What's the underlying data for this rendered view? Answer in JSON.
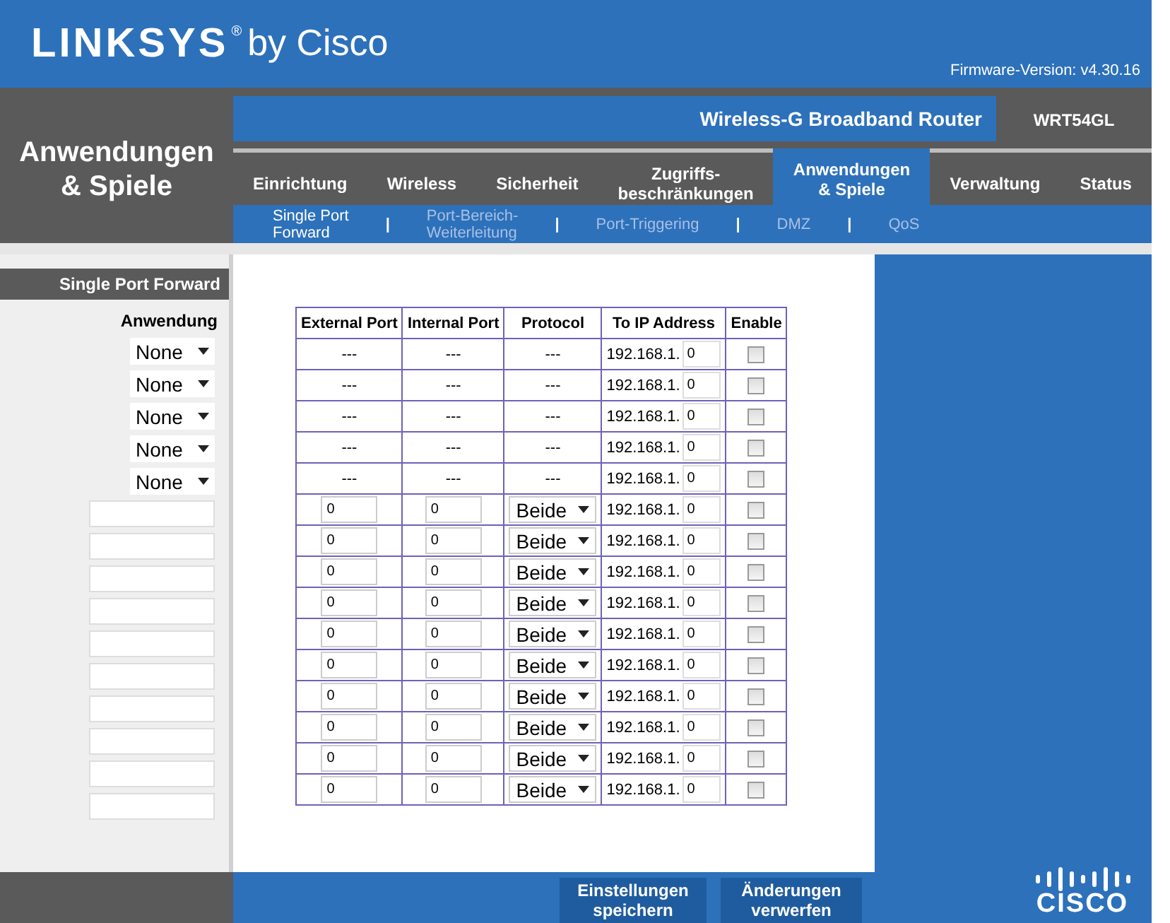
{
  "header": {
    "brand": "LINKSYS",
    "registered": "®",
    "by": "by Cisco",
    "firmware": "Firmware-Version: v4.30.16"
  },
  "section_title": "Anwendungen\n& Spiele",
  "product": {
    "name": "Wireless-G Broadband Router",
    "model": "WRT54GL"
  },
  "tabs": [
    {
      "label": "Einrichtung",
      "selected": false
    },
    {
      "label": "Wireless",
      "selected": false
    },
    {
      "label": "Sicherheit",
      "selected": false
    },
    {
      "label": "Zugriffs-\nbeschränkungen",
      "selected": false
    },
    {
      "label": "Anwendungen\n& Spiele",
      "selected": true
    },
    {
      "label": "Verwaltung",
      "selected": false
    },
    {
      "label": "Status",
      "selected": false
    }
  ],
  "subtabs": [
    {
      "label": "Single Port\nForward",
      "selected": true
    },
    {
      "label": "Port-Bereich-\nWeiterleitung",
      "selected": false
    },
    {
      "label": "Port-Triggering",
      "selected": false
    },
    {
      "label": "DMZ",
      "selected": false
    },
    {
      "label": "QoS",
      "selected": false
    }
  ],
  "subtab_separator": "|",
  "sidebar": {
    "title": "Single Port Forward",
    "column_label": "Anwendung"
  },
  "table": {
    "columns": [
      "External Port",
      "Internal Port",
      "Protocol",
      "To IP Address",
      "Enable"
    ],
    "rows": [
      {
        "kind": "fixed",
        "application": "None",
        "external_port": "---",
        "internal_port": "---",
        "protocol": "---",
        "ip_prefix": "192.168.1.",
        "ip_last": "0",
        "enabled": false
      },
      {
        "kind": "fixed",
        "application": "None",
        "external_port": "---",
        "internal_port": "---",
        "protocol": "---",
        "ip_prefix": "192.168.1.",
        "ip_last": "0",
        "enabled": false
      },
      {
        "kind": "fixed",
        "application": "None",
        "external_port": "---",
        "internal_port": "---",
        "protocol": "---",
        "ip_prefix": "192.168.1.",
        "ip_last": "0",
        "enabled": false
      },
      {
        "kind": "fixed",
        "application": "None",
        "external_port": "---",
        "internal_port": "---",
        "protocol": "---",
        "ip_prefix": "192.168.1.",
        "ip_last": "0",
        "enabled": false
      },
      {
        "kind": "fixed",
        "application": "None",
        "external_port": "---",
        "internal_port": "---",
        "protocol": "---",
        "ip_prefix": "192.168.1.",
        "ip_last": "0",
        "enabled": false
      },
      {
        "kind": "custom",
        "external_port": "0",
        "internal_port": "0",
        "protocol": "Beide",
        "ip_prefix": "192.168.1.",
        "ip_last": "0",
        "enabled": false
      },
      {
        "kind": "custom",
        "external_port": "0",
        "internal_port": "0",
        "protocol": "Beide",
        "ip_prefix": "192.168.1.",
        "ip_last": "0",
        "enabled": false
      },
      {
        "kind": "custom",
        "external_port": "0",
        "internal_port": "0",
        "protocol": "Beide",
        "ip_prefix": "192.168.1.",
        "ip_last": "0",
        "enabled": false
      },
      {
        "kind": "custom",
        "external_port": "0",
        "internal_port": "0",
        "protocol": "Beide",
        "ip_prefix": "192.168.1.",
        "ip_last": "0",
        "enabled": false
      },
      {
        "kind": "custom",
        "external_port": "0",
        "internal_port": "0",
        "protocol": "Beide",
        "ip_prefix": "192.168.1.",
        "ip_last": "0",
        "enabled": false
      },
      {
        "kind": "custom",
        "external_port": "0",
        "internal_port": "0",
        "protocol": "Beide",
        "ip_prefix": "192.168.1.",
        "ip_last": "0",
        "enabled": false
      },
      {
        "kind": "custom",
        "external_port": "0",
        "internal_port": "0",
        "protocol": "Beide",
        "ip_prefix": "192.168.1.",
        "ip_last": "0",
        "enabled": false
      },
      {
        "kind": "custom",
        "external_port": "0",
        "internal_port": "0",
        "protocol": "Beide",
        "ip_prefix": "192.168.1.",
        "ip_last": "0",
        "enabled": false
      },
      {
        "kind": "custom",
        "external_port": "0",
        "internal_port": "0",
        "protocol": "Beide",
        "ip_prefix": "192.168.1.",
        "ip_last": "0",
        "enabled": false
      },
      {
        "kind": "custom",
        "external_port": "0",
        "internal_port": "0",
        "protocol": "Beide",
        "ip_prefix": "192.168.1.",
        "ip_last": "0",
        "enabled": false
      }
    ]
  },
  "buttons": [
    "Einstellungen\nspeichern",
    "Änderungen\nverwerfen"
  ],
  "footer_logo": "CISCO"
}
